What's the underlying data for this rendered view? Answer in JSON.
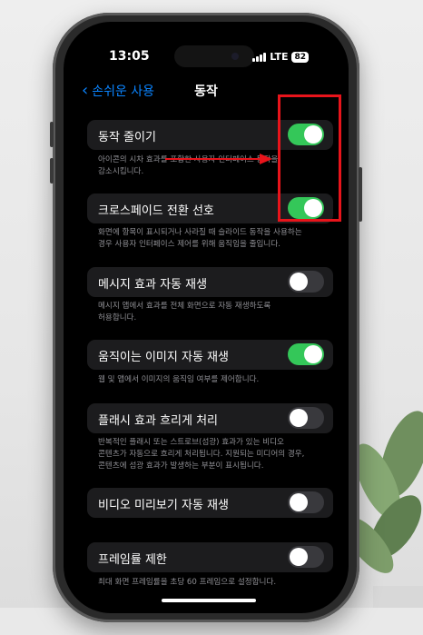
{
  "status": {
    "time": "13:05",
    "network": "LTE",
    "battery": "82"
  },
  "nav": {
    "back_label": "손쉬운 사용",
    "title": "동작"
  },
  "rows": [
    {
      "label": "동작 줄이기",
      "on": true,
      "desc": "아이콘의 시차 효과를 포함한 사용자 인터페이스 동작을\n감소시킵니다."
    },
    {
      "label": "크로스페이드 전환 선호",
      "on": true,
      "desc": "화면에 항목이 표시되거나 사라질 때 슬라이드 동작을 사용하는\n경우 사용자 인터페이스 제어를 위해 움직임을 줄입니다."
    },
    {
      "label": "메시지 효과 자동 재생",
      "on": false,
      "desc": "메시지 앱에서 효과를 전체 화면으로 자동 재생하도록\n허용합니다."
    },
    {
      "label": "움직이는 이미지 자동 재생",
      "on": true,
      "desc": "웹 및 앱에서 이미지의 움직임 여부를 제어합니다."
    },
    {
      "label": "플래시 효과 흐리게 처리",
      "on": false,
      "desc": "반복적인 플래시 또는 스트로브(섬광) 효과가 있는 비디오\n콘텐츠가 자동으로 흐리게 처리됩니다. 지원되는 미디어의 경우,\n콘텐츠에 섬광 효과가 발생하는 부분이 표시됩니다."
    },
    {
      "label": "비디오 미리보기 자동 재생",
      "on": false,
      "desc": ""
    },
    {
      "label": "프레임률 제한",
      "on": false,
      "desc": "최대 화면 프레임률을 초당 60 프레임으로 설정합니다."
    }
  ],
  "colors": {
    "toggle_on": "#34c759",
    "accent": "#0a84ff",
    "annotation": "#e8141b"
  }
}
